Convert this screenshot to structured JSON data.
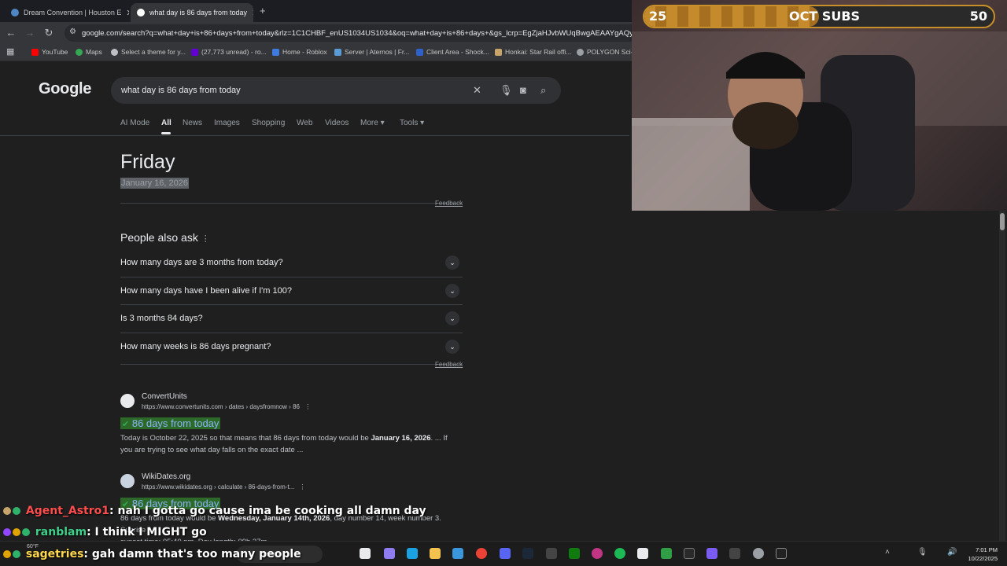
{
  "browser": {
    "tabs": [
      {
        "title": "Dream Convention | Houston E",
        "active": false
      },
      {
        "title": "what day is 86 days from today",
        "active": true
      }
    ],
    "new_tab": "+",
    "url": "google.com/search?q=what+day+is+86+days+from+today&rlz=1C1CHBF_enUS1034US1034&oq=what+day+is+86+days+&gs_lcrp=EgZjaHJvbWUqBwgAEAAYgAQyBwgA",
    "bookmarks": [
      "YouTube",
      "Maps",
      "Select a theme for y...",
      "(27,773 unread) - ro...",
      "Home - Roblox",
      "Server | Aternos | Fr...",
      "Client Area - Shock...",
      "Honkai: Star Rail offi...",
      "POLYGON Sci-Fi"
    ]
  },
  "google": {
    "logo": "Google",
    "query": "what day is 86 days from today",
    "tabs": [
      "AI Mode",
      "All",
      "News",
      "Images",
      "Shopping",
      "Web",
      "Videos",
      "More",
      "Tools"
    ],
    "answer": {
      "day": "Friday",
      "date": "January 16, 2026",
      "feedback": "Feedback"
    },
    "paa": {
      "title": "People also ask",
      "questions": [
        "How many days are 3 months from today?",
        "How many days have I been alive if I'm 100?",
        "Is 3 months 84 days?",
        "How many weeks is 86 days pregnant?"
      ],
      "feedback": "Feedback"
    },
    "results": [
      {
        "site": "ConvertUnits",
        "url": "https://www.convertunits.com › dates › daysfromnow › 86",
        "title": "86 days from today",
        "snippet_a": "Today is October 22, 2025 so that means that 86 days from today would be ",
        "snippet_bold": "January 16, 2026",
        "snippet_b": ". ... If you are trying to see what day falls on the exact date ..."
      },
      {
        "site": "WikiDates.org",
        "url": "https://www.wikidates.org › calculate › 86-days-from-t...",
        "title": "86 days from today",
        "snippet_a": "86 days from today would be ",
        "snippet_bold": "Wednesday, January 14th, 2026",
        "snippet_b": ", day number 14, week number 3. Sunrise",
        "snippet_c": "sunset time: 05:40 pm, Day length: 09h 37m ..."
      }
    ]
  },
  "stream": {
    "sub_goal": {
      "current": "25",
      "label": "OCT SUBS",
      "target": "50",
      "progress": 0.5
    },
    "chat": [
      {
        "user": "Agent_Astro1",
        "message": ": nah I gotta go cause ima be cooking all damn day",
        "color": "#ff4d4d"
      },
      {
        "user": "ranblam",
        "message": ": I think I MIGHT go",
        "color": "#3fd18a"
      },
      {
        "user": "sagetries",
        "message": ": gah damn that's too many people",
        "color": "#ffd84d"
      }
    ]
  },
  "taskbar": {
    "weather": "60°F",
    "search": "Search",
    "time": "7:01 PM",
    "date": "10/22/2025"
  }
}
